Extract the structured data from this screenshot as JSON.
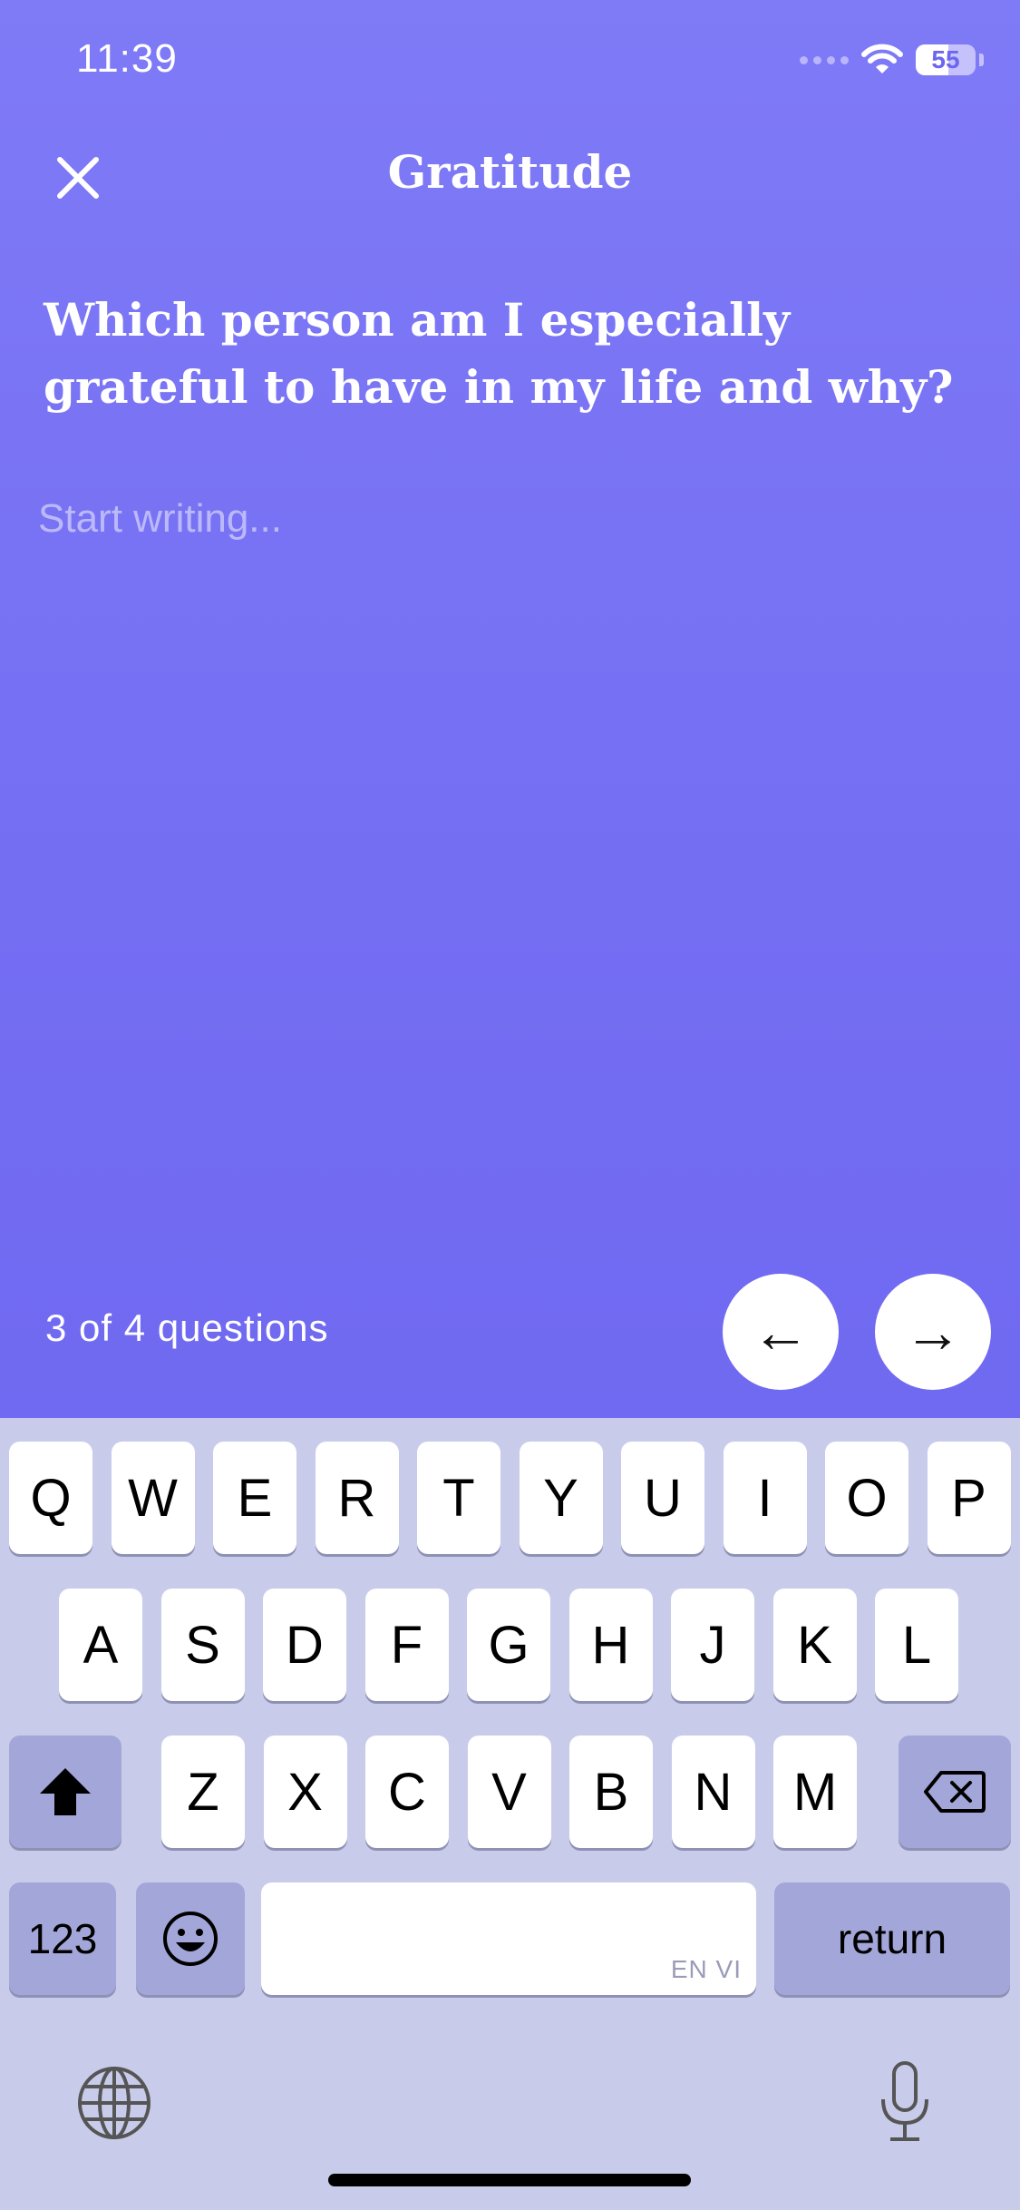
{
  "status_bar": {
    "time": "11:39",
    "battery": "55",
    "battery_level": 0.55
  },
  "header": {
    "title": "Gratitude"
  },
  "prompt": {
    "question": "Which person am I especially grateful to have in my life and why?"
  },
  "entry": {
    "placeholder": "Start writing...",
    "value": ""
  },
  "footer": {
    "progress": "3 of 4 questions",
    "prev_label": "←",
    "next_label": "→"
  },
  "keyboard": {
    "row1": [
      "Q",
      "W",
      "E",
      "R",
      "T",
      "Y",
      "U",
      "I",
      "O",
      "P"
    ],
    "row2": [
      "A",
      "S",
      "D",
      "F",
      "G",
      "H",
      "J",
      "K",
      "L"
    ],
    "row3": [
      "Z",
      "X",
      "C",
      "V",
      "B",
      "N",
      "M"
    ],
    "numbers_label": "123",
    "return_label": "return",
    "space_languages": "EN VI",
    "icons": [
      "shift-icon",
      "backspace-icon",
      "emoji-icon",
      "globe-icon",
      "microphone-icon"
    ]
  },
  "colors": {
    "background": "#7570f2",
    "keyboard": "#c9cbeb",
    "special_key": "#a3a6d8"
  }
}
